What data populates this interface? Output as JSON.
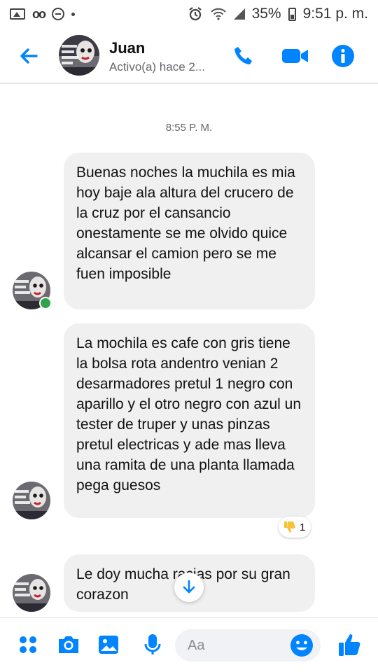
{
  "status_bar": {
    "battery_percent": "35%",
    "time": "9:51 p. m."
  },
  "header": {
    "contact_name": "Juan",
    "contact_status": "Activo(a) hace 2..."
  },
  "conversation": {
    "timestamp": "8:55 P. M.",
    "messages": [
      {
        "text": "Buenas noches la muchila es mia hoy baje ala altura del crucero de la cruz por el cansancio onestamente se me olvido quice alcansar el camion pero se me fuen imposible"
      },
      {
        "text": "La mochila es cafe con gris tiene la bolsa rota andentro venian 2 desarmadores pretul 1 negro con aparillo y el otro negro con azul un tester de truper y unas pinzas pretul electricas y ade mas lleva una ramita de una planta llamada pega guesos",
        "reaction_count": "1"
      },
      {
        "text": "Le doy mucha   racias por su gran corazon"
      }
    ]
  },
  "composer": {
    "placeholder": "Aa"
  },
  "colors": {
    "accent": "#0084ff",
    "bubble": "#f0f0f0",
    "online": "#31a24c",
    "reaction": "#f5c33b"
  },
  "icons": [
    "back-arrow-icon",
    "phone-icon",
    "video-camera-icon",
    "info-icon",
    "apps-icon",
    "camera-icon",
    "gallery-icon",
    "microphone-icon",
    "emoji-icon",
    "thumbs-up-icon",
    "scroll-down-icon"
  ]
}
